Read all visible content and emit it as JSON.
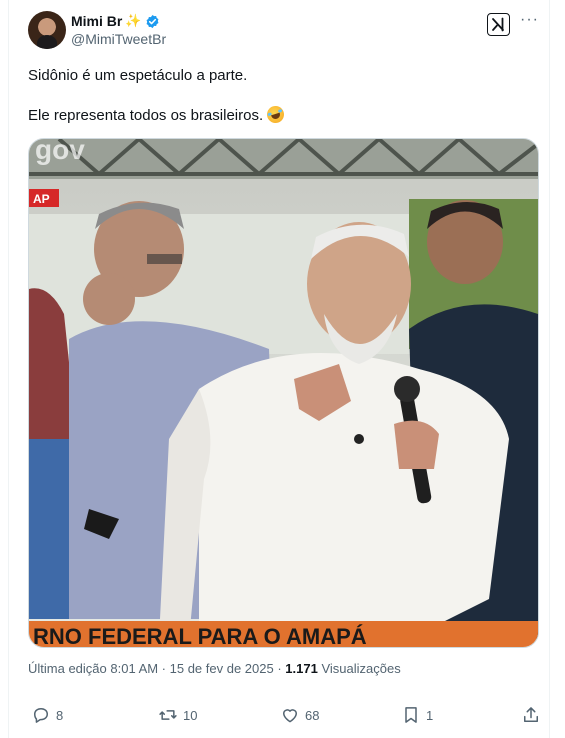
{
  "author": {
    "display_name": "Mimi Br",
    "name_emoji": "✨",
    "handle": "@MimiTweetBr"
  },
  "tweet": {
    "line1": "Sidônio é um espetáculo a parte.",
    "line2": "Ele representa todos os brasileiros."
  },
  "media": {
    "logo_text": "gov",
    "badge_text": "AP",
    "banner_text": "RNO FEDERAL PARA O AMAPÁ"
  },
  "meta": {
    "edited_label": "Última edição 8:01 AM · 15 de fev de 2025 ·",
    "views_count": "1.171",
    "views_label": "Visualizações"
  },
  "actions": {
    "replies": "8",
    "reposts": "10",
    "likes": "68",
    "bookmarks": "1"
  },
  "colors": {
    "verified": "#1d9bf0",
    "secondary_text": "#536471",
    "banner": "#e1722e"
  }
}
